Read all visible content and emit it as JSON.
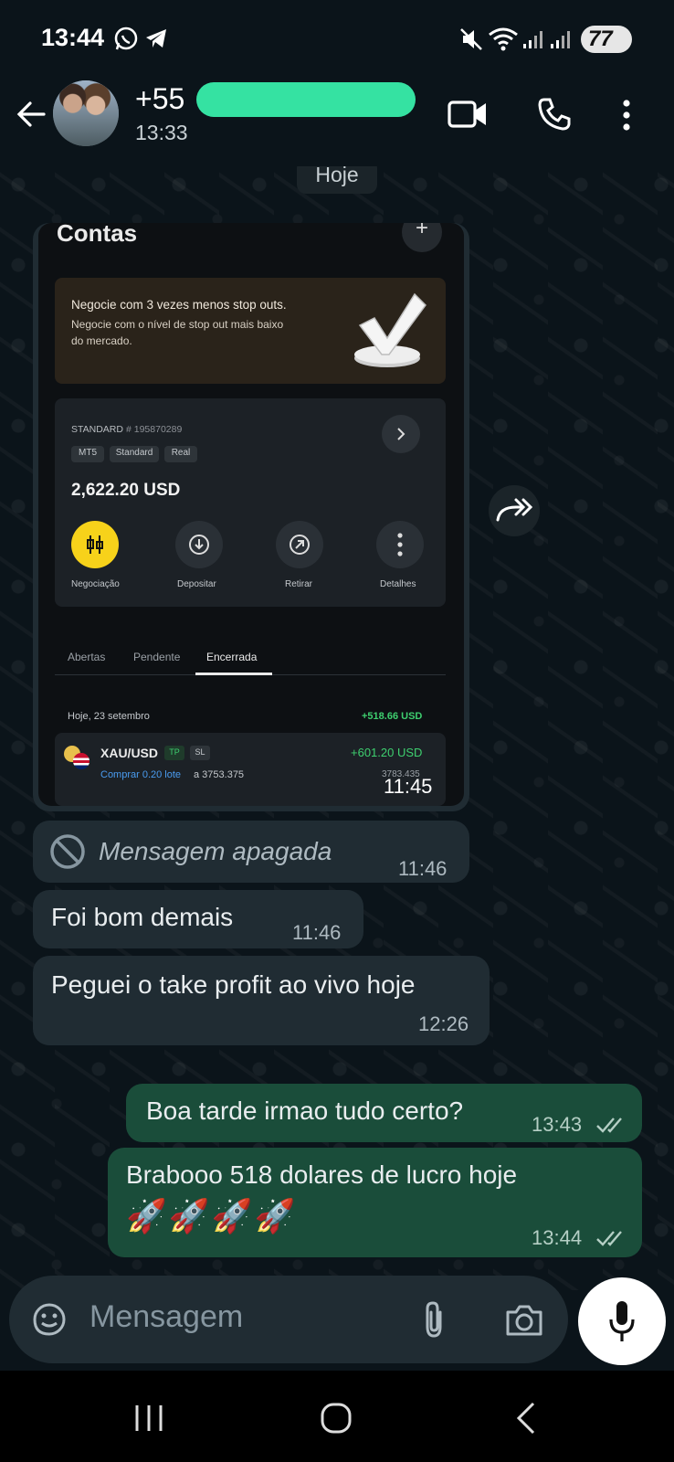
{
  "status_bar": {
    "time": "13:44",
    "battery": "77"
  },
  "header": {
    "contact_name": "+55",
    "last_seen": "13:33"
  },
  "chat": {
    "date_chip": "Hoje",
    "image_message": {
      "time": "11:45",
      "screenshot": {
        "title": "Contas",
        "plus": "+",
        "promo_title": "Negocie com 3 vezes menos stop outs.",
        "promo_body_1": "Negocie com o nível de stop out mais baixo",
        "promo_body_2": "do mercado.",
        "account_type": "STANDARD",
        "account_number": "# 195870289",
        "tags": [
          "MT5",
          "Standard",
          "Real"
        ],
        "balance": "2,622.20 USD",
        "actions": [
          "Negociação",
          "Depositar",
          "Retirar",
          "Detalhes"
        ],
        "tabs": [
          "Abertas",
          "Pendente",
          "Encerrada"
        ],
        "day_label": "Hoje, 23 setembro",
        "day_total": "+518.66 USD",
        "trade_symbol": "XAU/USD",
        "trade_tp": "TP",
        "trade_sl": "SL",
        "trade_profit": "+601.20 USD",
        "trade_detail_action": "Comprar 0.20 lote",
        "trade_detail_price": "a 3753.375",
        "trade_close_price": "3783.435"
      }
    },
    "deleted_message": {
      "text": "Mensagem apagada",
      "time": "11:46"
    },
    "incoming": [
      {
        "text": "Foi bom demais",
        "time": "11:46"
      },
      {
        "text": "Peguei o take profit ao vivo hoje",
        "time": "12:26"
      }
    ],
    "outgoing": [
      {
        "text": "Boa tarde irmao tudo certo?",
        "time": "13:43"
      },
      {
        "text": "Brabooo 518 dolares de lucro hoje",
        "emoji": "🚀🚀🚀🚀",
        "time": "13:44"
      }
    ]
  },
  "composer": {
    "placeholder": "Mensagem"
  },
  "colors": {
    "accent": "#00a884",
    "outgoing_bubble": "#1a4d3a",
    "incoming_bubble": "#202c33",
    "background": "#0b141a",
    "trade_yellow": "#f7d21a",
    "profit_green": "#3ecf6f"
  }
}
